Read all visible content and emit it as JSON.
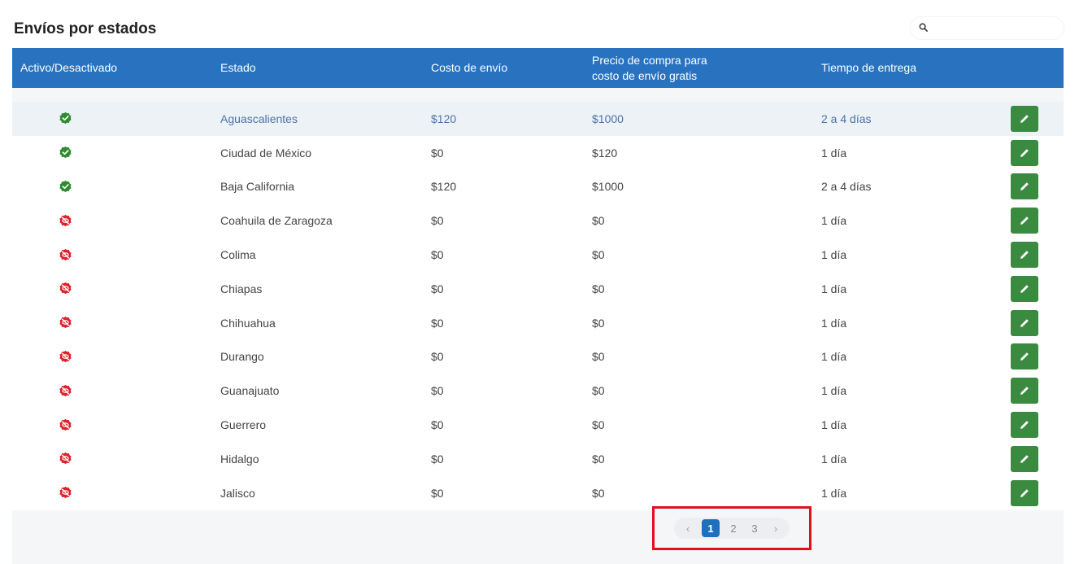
{
  "page": {
    "title": "Envíos por estados"
  },
  "search": {
    "placeholder": "",
    "value": ""
  },
  "table": {
    "headers": {
      "activo": "Activo/Desactivado",
      "estado": "Estado",
      "costo": "Costo de envío",
      "precio_line1": "Precio de compra para",
      "precio_line2": "costo de envío gratis",
      "tiempo": "Tiempo de entrega"
    },
    "rows": [
      {
        "active": true,
        "estado": "Aguascalientes",
        "costo": "$120",
        "precio": "$1000",
        "tiempo": "2 a 4 días"
      },
      {
        "active": true,
        "estado": "Ciudad de México",
        "costo": "$0",
        "precio": "$120",
        "tiempo": "1 día"
      },
      {
        "active": true,
        "estado": "Baja California",
        "costo": "$120",
        "precio": "$1000",
        "tiempo": "2 a 4 días"
      },
      {
        "active": false,
        "estado": "Coahuila de Zaragoza",
        "costo": "$0",
        "precio": "$0",
        "tiempo": "1 día"
      },
      {
        "active": false,
        "estado": "Colima",
        "costo": "$0",
        "precio": "$0",
        "tiempo": "1 día"
      },
      {
        "active": false,
        "estado": "Chiapas",
        "costo": "$0",
        "precio": "$0",
        "tiempo": "1 día"
      },
      {
        "active": false,
        "estado": "Chihuahua",
        "costo": "$0",
        "precio": "$0",
        "tiempo": "1 día"
      },
      {
        "active": false,
        "estado": "Durango",
        "costo": "$0",
        "precio": "$0",
        "tiempo": "1 día"
      },
      {
        "active": false,
        "estado": "Guanajuato",
        "costo": "$0",
        "precio": "$0",
        "tiempo": "1 día"
      },
      {
        "active": false,
        "estado": "Guerrero",
        "costo": "$0",
        "precio": "$0",
        "tiempo": "1 día"
      },
      {
        "active": false,
        "estado": "Hidalgo",
        "costo": "$0",
        "precio": "$0",
        "tiempo": "1 día"
      },
      {
        "active": false,
        "estado": "Jalisco",
        "costo": "$0",
        "precio": "$0",
        "tiempo": "1 día"
      }
    ],
    "highlighted_row": 0
  },
  "pagination": {
    "prev_label": "‹",
    "next_label": "›",
    "pages": [
      "1",
      "2",
      "3"
    ],
    "current": "1"
  },
  "colors": {
    "header_bg": "#2872c0",
    "active_icon": "#2e8b2e",
    "inactive_icon": "#e0202a",
    "edit_button": "#3a8a3f",
    "highlight_box": "#e0101c"
  },
  "icons": {
    "search": "search-icon",
    "active": "check-badge-icon",
    "inactive": "no-eye-icon",
    "edit": "pencil-icon"
  }
}
